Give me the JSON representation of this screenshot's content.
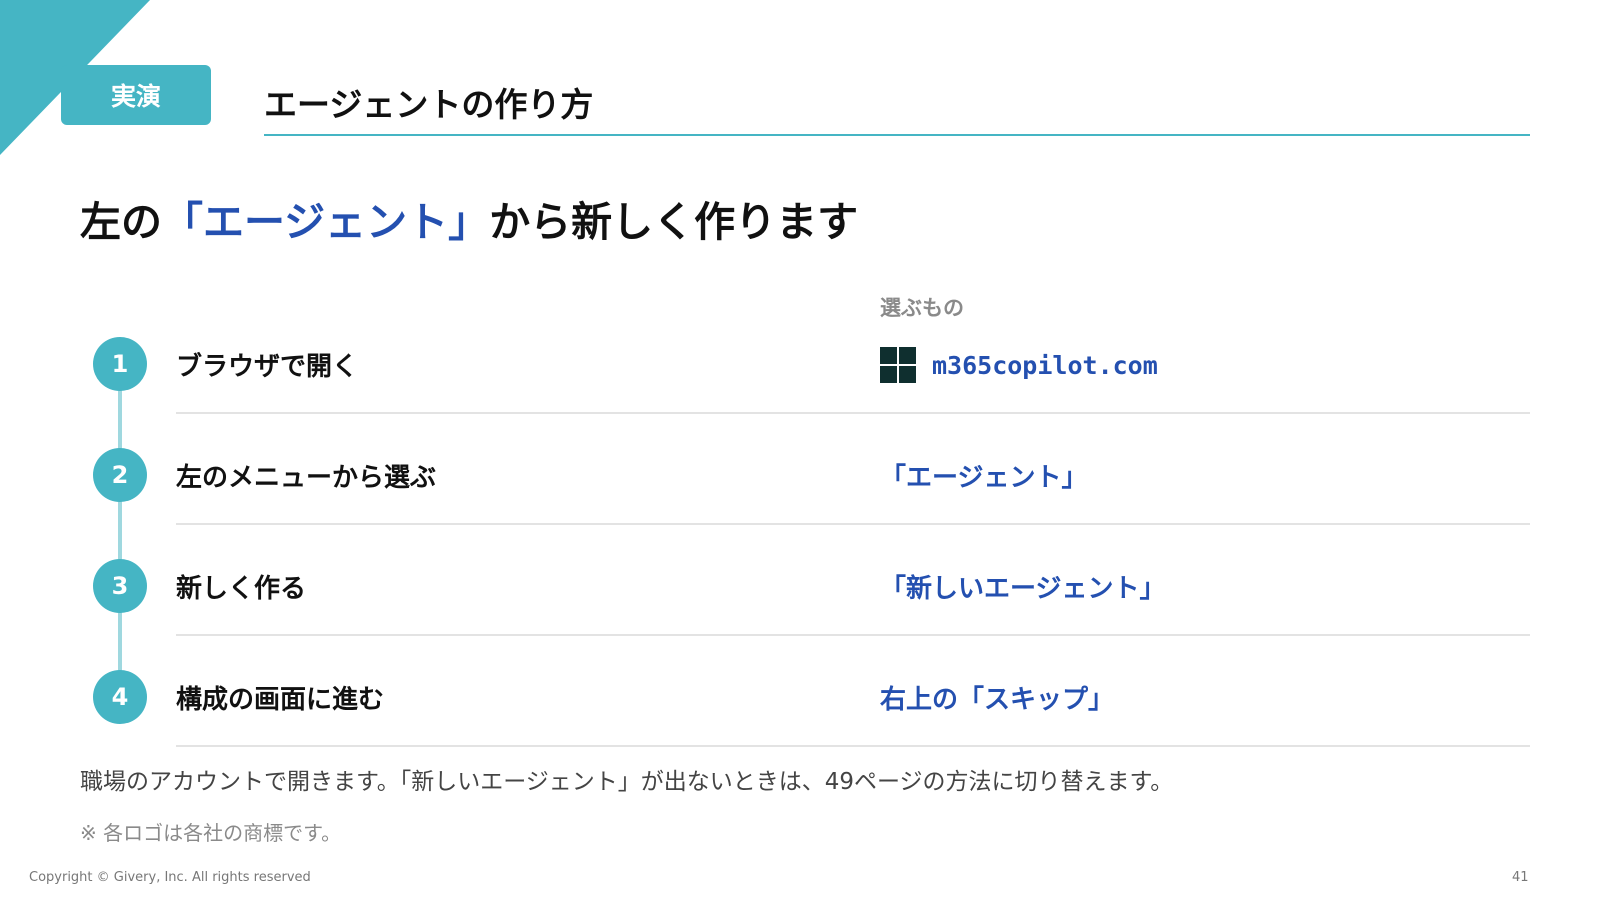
{
  "header": {
    "badge": "実演",
    "title": "エージェントの作り方"
  },
  "headline": {
    "before": "左の",
    "highlight": "「エージェント」",
    "after": "から新しく作ります"
  },
  "column_header": "選ぶもの",
  "steps": [
    {
      "number": "1",
      "label": "ブラウザで開く",
      "value": "m365copilot.com",
      "icon": "windows-logo-icon"
    },
    {
      "number": "2",
      "label": "左のメニューから選ぶ",
      "value": "「エージェント」"
    },
    {
      "number": "3",
      "label": "新しく作る",
      "value": "「新しいエージェント」"
    },
    {
      "number": "4",
      "label": "構成の画面に進む",
      "value": "右上の「スキップ」"
    }
  ],
  "note": "職場のアカウントで開きます。「新しいエージェント」が出ないときは、49ページの方法に切り替えます。",
  "footnote": "※ 各ロゴは各社の商標です。",
  "footer": {
    "copyright": "Copyright © Givery, Inc. All rights reserved",
    "page_number": "41"
  },
  "colors": {
    "accent": "#45b5c4",
    "highlight_text": "#2450b0",
    "muted": "#8a8a8a"
  }
}
